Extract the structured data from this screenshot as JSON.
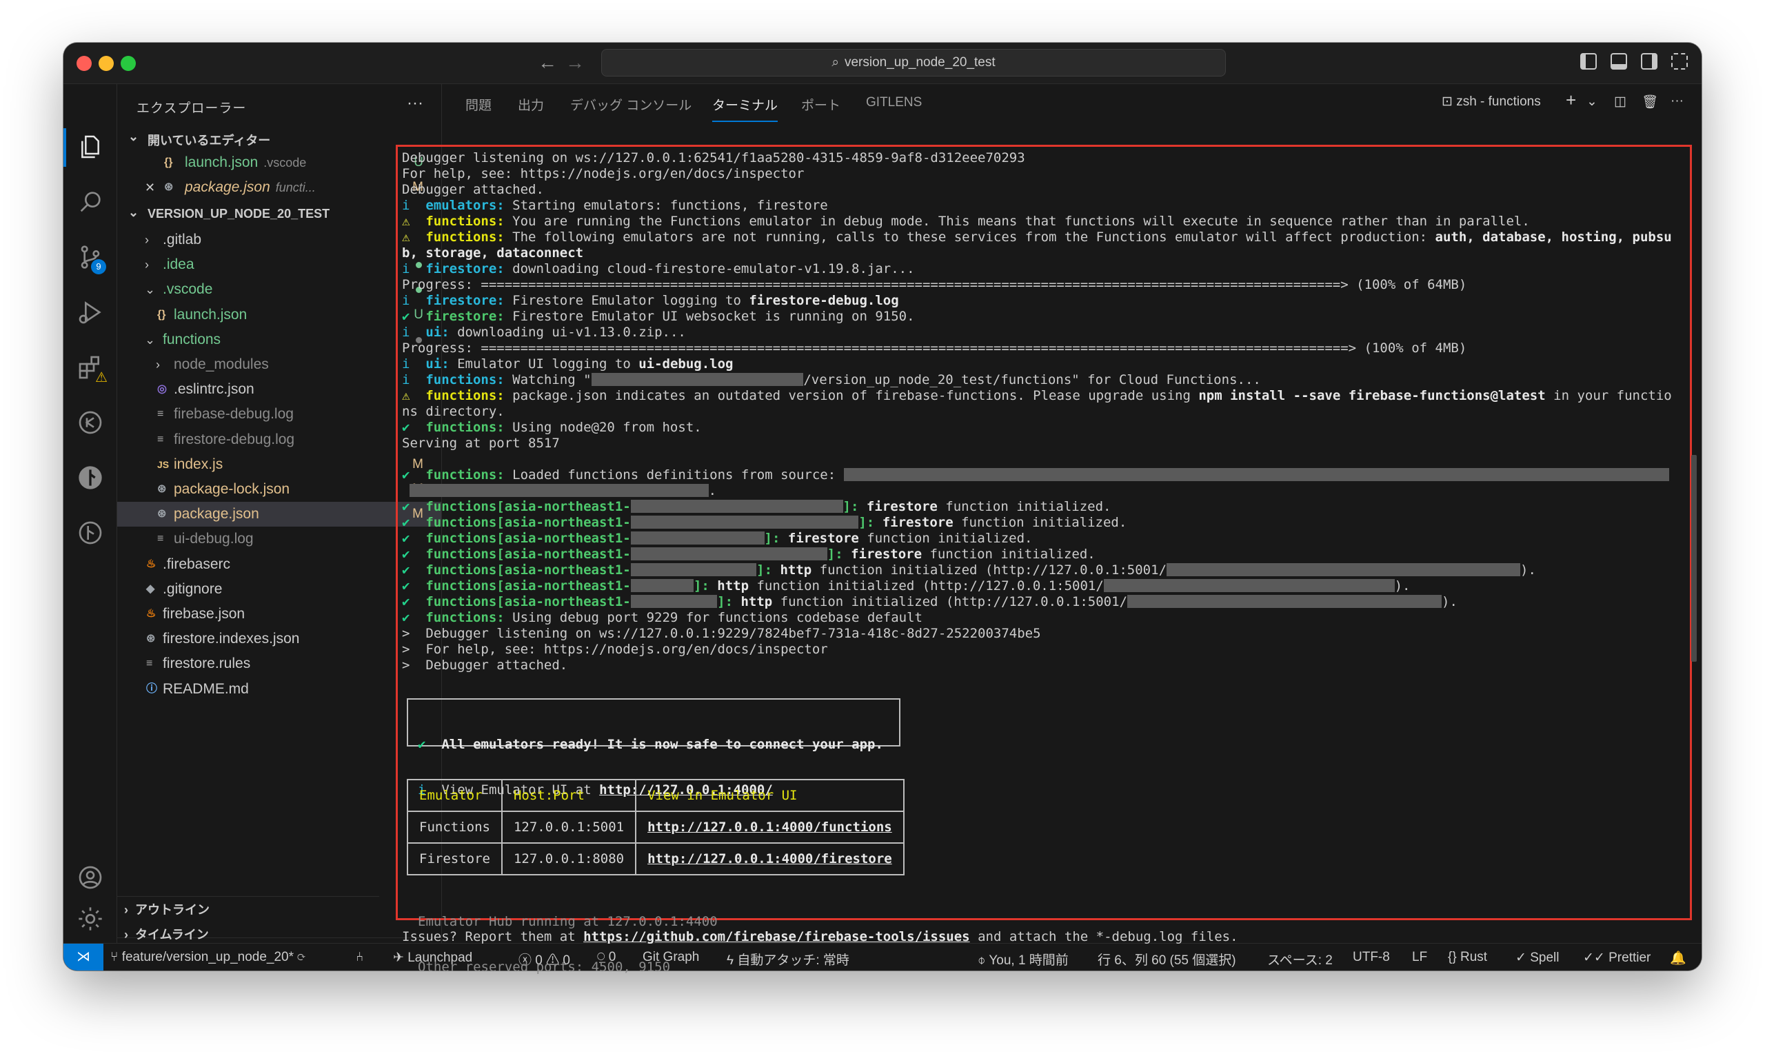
{
  "window": {
    "title": "version_up_node_20_test"
  },
  "activity_bar": {
    "source_control_badge": "9",
    "icons": [
      "explorer-icon",
      "search-icon",
      "source-control-icon",
      "run-debug-icon",
      "extensions-icon",
      "remote-explorer-icon",
      "gitlens-icon",
      "timeline-icon",
      "accounts-icon",
      "settings-gear-icon"
    ]
  },
  "sidebar": {
    "header": "エクスプローラー",
    "open_editors_label": "開いているエディター",
    "open_editors": [
      {
        "name": "launch.json",
        "extra": ".vscode",
        "status": "U"
      },
      {
        "name": "package.json",
        "extra": "functi...",
        "status": "M"
      }
    ],
    "project_label": "VERSION_UP_NODE_20_TEST",
    "tree": [
      {
        "name": ".gitlab",
        "kind": "folder",
        "status": ""
      },
      {
        "name": ".idea",
        "kind": "folder",
        "status": "dot"
      },
      {
        "name": ".vscode",
        "kind": "folder-open",
        "status": "dot"
      },
      {
        "name": "launch.json",
        "kind": "braces",
        "status": "U"
      },
      {
        "name": "functions",
        "kind": "folder-open",
        "status": "dot"
      },
      {
        "name": "node_modules",
        "kind": "folder",
        "status": ""
      },
      {
        "name": ".eslintrc.json",
        "kind": "eslint",
        "status": ""
      },
      {
        "name": "firebase-debug.log",
        "kind": "lines",
        "status": ""
      },
      {
        "name": "firestore-debug.log",
        "kind": "lines",
        "status": ""
      },
      {
        "name": "index.js",
        "kind": "js",
        "status": "M"
      },
      {
        "name": "package-lock.json",
        "kind": "npm",
        "status": "M"
      },
      {
        "name": "package.json",
        "kind": "npm",
        "status": "M"
      },
      {
        "name": "ui-debug.log",
        "kind": "lines",
        "status": ""
      },
      {
        "name": ".firebaserc",
        "kind": "fire",
        "status": ""
      },
      {
        "name": ".gitignore",
        "kind": "git",
        "status": ""
      },
      {
        "name": "firebase.json",
        "kind": "fire",
        "status": ""
      },
      {
        "name": "firestore.indexes.json",
        "kind": "npm",
        "status": ""
      },
      {
        "name": "firestore.rules",
        "kind": "lines",
        "status": ""
      },
      {
        "name": "README.md",
        "kind": "info",
        "status": ""
      }
    ],
    "outline_label": "アウトライン",
    "timeline_label": "タイムライン"
  },
  "panel": {
    "tabs": [
      "問題",
      "出力",
      "デバッグ コンソール",
      "ターミナル",
      "ポート",
      "GITLENS"
    ],
    "active_tab": "ターミナル",
    "terminal_name": "zsh - functions"
  },
  "terminal": {
    "lines": [
      {
        "parts": [
          [
            "",
            "Debugger listening on ws://127.0.0.1:62541/f1aa5280-4315-4859-9af8-d312eee70293"
          ]
        ]
      },
      {
        "parts": [
          [
            "",
            "For help, see: https://nodejs.org/en/docs/inspector"
          ]
        ]
      },
      {
        "parts": [
          [
            "",
            "Debugger attached."
          ]
        ]
      },
      {
        "parts": [
          [
            "in",
            "i  "
          ],
          [
            "cy",
            "emulators:"
          ],
          [
            "",
            " Starting emulators: functions, firestore"
          ]
        ]
      },
      {
        "parts": [
          [
            "wn",
            "⚠  "
          ],
          [
            "ye",
            "functions:"
          ],
          [
            "",
            " You are running the Functions emulator in debug mode. This means that functions will execute in sequence rather than in parallel."
          ]
        ]
      },
      {
        "parts": [
          [
            "wn",
            "⚠  "
          ],
          [
            "ye",
            "functions:"
          ],
          [
            "",
            " The following emulators are not running, calls to these services from the Functions emulator will affect production: "
          ],
          [
            "b",
            "auth, database, hosting, pubsu"
          ]
        ]
      },
      {
        "parts": [
          [
            "b",
            "b, storage, dataconnect"
          ]
        ]
      },
      {
        "parts": [
          [
            "in",
            "i  "
          ],
          [
            "cy",
            "firestore:"
          ],
          [
            "",
            " downloading cloud-firestore-emulator-v1.19.8.jar..."
          ]
        ]
      },
      {
        "parts": [
          [
            "",
            "Progress: =============================================================================================================> (100% of 64MB)"
          ]
        ]
      },
      {
        "parts": [
          [
            "in",
            "i  "
          ],
          [
            "cy",
            "firestore:"
          ],
          [
            "",
            " Firestore Emulator logging to "
          ],
          [
            "b",
            "firestore-debug.log"
          ]
        ]
      },
      {
        "parts": [
          [
            "ck",
            "✔  "
          ],
          [
            "gr",
            "firestore:"
          ],
          [
            "",
            " Firestore Emulator UI websocket is running on 9150."
          ]
        ]
      },
      {
        "parts": [
          [
            "in",
            "i  "
          ],
          [
            "cy",
            "ui:"
          ],
          [
            "",
            " downloading ui-v1.13.0.zip..."
          ]
        ]
      },
      {
        "parts": [
          [
            "",
            "Progress: ==============================================================================================================> (100% of 4MB)"
          ]
        ]
      },
      {
        "parts": [
          [
            "in",
            "i  "
          ],
          [
            "cy",
            "ui:"
          ],
          [
            "",
            " Emulator UI logging to "
          ],
          [
            "b",
            "ui-debug.log"
          ]
        ]
      },
      {
        "parts": [
          [
            "in",
            "i  "
          ],
          [
            "cy",
            "functions:"
          ],
          [
            "",
            " Watching \""
          ],
          [
            "redact",
            "27"
          ],
          [
            "",
            "/version_up_node_20_test/functions\" for Cloud Functions..."
          ]
        ]
      },
      {
        "parts": [
          [
            "wn",
            "⚠  "
          ],
          [
            "ye",
            "functions:"
          ],
          [
            "",
            " package.json indicates an outdated version of firebase-functions. Please upgrade using "
          ],
          [
            "b",
            "npm install --save firebase-functions@latest"
          ],
          [
            "",
            " in your functio"
          ]
        ]
      },
      {
        "parts": [
          [
            "",
            "ns directory."
          ]
        ]
      },
      {
        "parts": [
          [
            "ck",
            "✔  "
          ],
          [
            "gr",
            "functions:"
          ],
          [
            "",
            " Using node@20 from host."
          ]
        ]
      },
      {
        "parts": [
          [
            "",
            "Serving at port 8517"
          ]
        ]
      },
      {
        "parts": [
          [
            "",
            ""
          ]
        ]
      },
      {
        "parts": [
          [
            "ck",
            "✔  "
          ],
          [
            "gr",
            "functions:"
          ],
          [
            "",
            " Loaded functions definitions from source: "
          ],
          [
            "redact",
            "105"
          ]
        ]
      },
      {
        "parts": [
          [
            "",
            " "
          ],
          [
            "redact",
            "38"
          ],
          [
            "",
            "."
          ]
        ]
      },
      {
        "parts": [
          [
            "ck",
            "✔  "
          ],
          [
            "gr",
            "functions[asia-northeast1-"
          ],
          [
            "redact",
            "27"
          ],
          [
            "gr",
            "]:"
          ],
          [
            "",
            " "
          ],
          [
            "b",
            "firestore"
          ],
          [
            "",
            " function initialized."
          ]
        ]
      },
      {
        "parts": [
          [
            "ck",
            "✔  "
          ],
          [
            "gr",
            "functions[asia-northeast1-"
          ],
          [
            "redact",
            "29"
          ],
          [
            "gr",
            "]:"
          ],
          [
            "",
            " "
          ],
          [
            "b",
            "firestore"
          ],
          [
            "",
            " function initialized."
          ]
        ]
      },
      {
        "parts": [
          [
            "ck",
            "✔  "
          ],
          [
            "gr",
            "functions[asia-northeast1-"
          ],
          [
            "redact",
            "17"
          ],
          [
            "gr",
            "]:"
          ],
          [
            "",
            " "
          ],
          [
            "b",
            "firestore"
          ],
          [
            "",
            " function initialized."
          ]
        ]
      },
      {
        "parts": [
          [
            "ck",
            "✔  "
          ],
          [
            "gr",
            "functions[asia-northeast1-"
          ],
          [
            "redact",
            "25"
          ],
          [
            "gr",
            "]:"
          ],
          [
            "",
            " "
          ],
          [
            "b",
            "firestore"
          ],
          [
            "",
            " function initialized."
          ]
        ]
      },
      {
        "parts": [
          [
            "ck",
            "✔  "
          ],
          [
            "gr",
            "functions[asia-northeast1-"
          ],
          [
            "redact",
            "16"
          ],
          [
            "gr",
            "]:"
          ],
          [
            "",
            " "
          ],
          [
            "b",
            "http"
          ],
          [
            "",
            " function initialized (http://127.0.0.1:5001/"
          ],
          [
            "redact",
            "45"
          ],
          [
            "",
            ")."
          ]
        ]
      },
      {
        "parts": [
          [
            "ck",
            "✔  "
          ],
          [
            "gr",
            "functions[asia-northeast1-"
          ],
          [
            "redact",
            "8"
          ],
          [
            "gr",
            "]:"
          ],
          [
            "",
            " "
          ],
          [
            "b",
            "http"
          ],
          [
            "",
            " function initialized (http://127.0.0.1:5001/"
          ],
          [
            "redact",
            "37"
          ],
          [
            "",
            ")."
          ]
        ]
      },
      {
        "parts": [
          [
            "ck",
            "✔  "
          ],
          [
            "gr",
            "functions[asia-northeast1-"
          ],
          [
            "redact",
            "11"
          ],
          [
            "gr",
            "]:"
          ],
          [
            "",
            " "
          ],
          [
            "b",
            "http"
          ],
          [
            "",
            " function initialized (http://127.0.0.1:5001/"
          ],
          [
            "redact",
            "40"
          ],
          [
            "",
            ")."
          ]
        ]
      },
      {
        "parts": [
          [
            "ck",
            "✔  "
          ],
          [
            "gr",
            "functions:"
          ],
          [
            "",
            " Using debug port 9229 for functions codebase default"
          ]
        ]
      },
      {
        "parts": [
          [
            "",
            ">  Debugger listening on ws://127.0.0.1:9229/7824bef7-731a-418c-8d27-252200374be5"
          ]
        ]
      },
      {
        "parts": [
          [
            "",
            ">  For help, see: https://nodejs.org/en/docs/inspector"
          ]
        ]
      },
      {
        "parts": [
          [
            "",
            ">  Debugger attached."
          ]
        ]
      }
    ],
    "ready_line_1": "All emulators ready! It is now safe to connect your app.",
    "ready_line_2_prefix": "View Emulator UI at ",
    "ready_url": "http://127.0.0.1:4000/",
    "table_headers": [
      "Emulator",
      "Host:Port",
      "View in Emulator UI"
    ],
    "table_rows": [
      [
        "Functions",
        "127.0.0.1:5001",
        "http://127.0.0.1:4000/functions"
      ],
      [
        "Firestore",
        "127.0.0.1:8080",
        "http://127.0.0.1:4000/firestore"
      ]
    ],
    "hub_line": "Emulator Hub running at 127.0.0.1:4400",
    "reserved_line": "Other reserved ports: 4500, 9150",
    "issues_prefix": "Issues? Report them at ",
    "issues_url": "https://github.com/firebase/firebase-tools/issues",
    "issues_suffix": " and attach the *-debug.log files."
  },
  "statusbar": {
    "branch": "feature/version_up_node_20*",
    "launchpad": "Launchpad",
    "errors": "0",
    "warnings": "0",
    "ports": "0",
    "git_graph": "Git Graph",
    "auto_attach": "自動アタッチ: 常時",
    "blame": "You, 1 時間前",
    "cursor": "行 6、列 60 (55 個選択)",
    "spaces": "スペース: 2",
    "encoding": "UTF-8",
    "eol": "LF",
    "language": "Rust",
    "spell": "Spell",
    "prettier": "Prettier"
  },
  "colors": {
    "accent": "#0078d4",
    "highlight_border": "#e0362c",
    "ansi_cyan": "#29b8db",
    "ansi_green": "#4ec96d",
    "ansi_yellow": "#e5e510"
  }
}
